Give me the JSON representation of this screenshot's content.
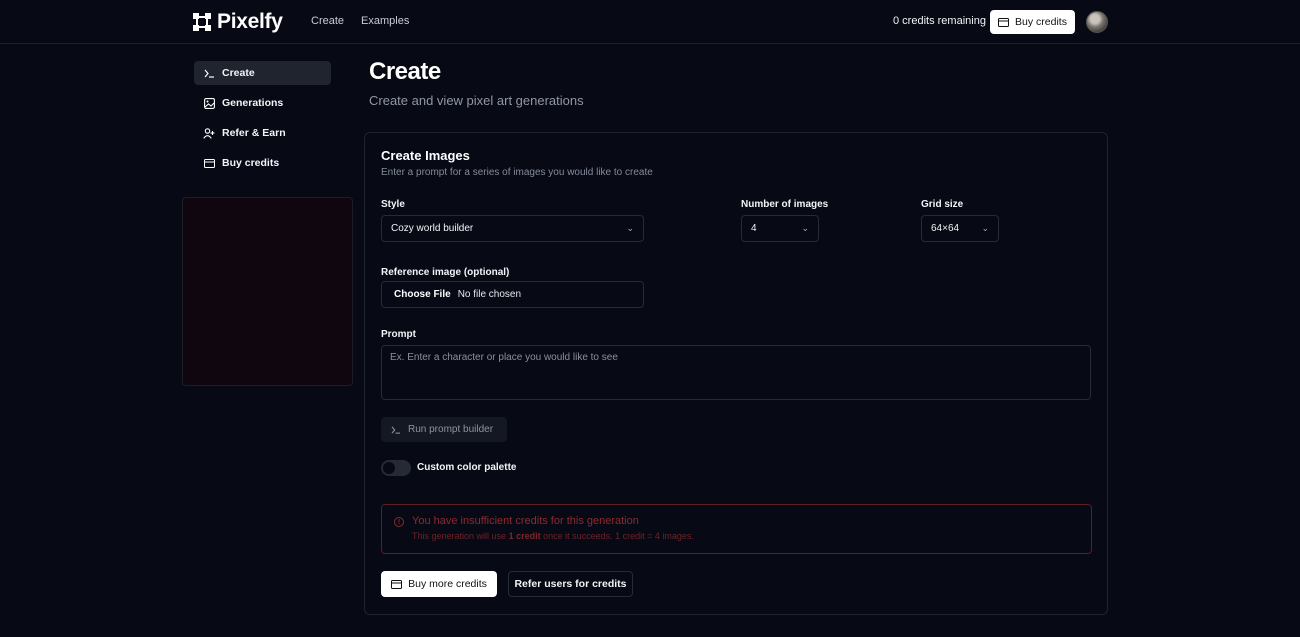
{
  "header": {
    "brand": "Pixelfy",
    "nav": [
      "Create",
      "Examples"
    ],
    "credits_text": "0 credits remaining",
    "buy_label": "Buy credits"
  },
  "sidebar": {
    "items": [
      {
        "label": "Create",
        "icon": "terminal-icon",
        "active": true
      },
      {
        "label": "Generations",
        "icon": "gallery-icon",
        "active": false
      },
      {
        "label": "Refer & Earn",
        "icon": "user-plus-icon",
        "active": false
      },
      {
        "label": "Buy credits",
        "icon": "credit-card-icon",
        "active": false
      }
    ]
  },
  "main": {
    "title": "Create",
    "subtitle": "Create and view pixel art generations"
  },
  "card": {
    "title": "Create Images",
    "description": "Enter a prompt for a series of images you would like to create",
    "style": {
      "label": "Style",
      "value": "Cozy world builder"
    },
    "num_images": {
      "label": "Number of images",
      "value": "4"
    },
    "grid_size": {
      "label": "Grid size",
      "value": "64×64"
    },
    "reference": {
      "label": "Reference image (optional)",
      "button": "Choose File",
      "status": "No file chosen"
    },
    "prompt": {
      "label": "Prompt",
      "placeholder": "Ex. Enter a character or place you would like to see"
    },
    "prompt_builder_label": "Run prompt builder",
    "palette_toggle": {
      "label": "Custom color palette",
      "on": false
    },
    "alert": {
      "title": "You have insufficient credits for this generation",
      "desc_prefix": "This generation will use ",
      "desc_bold": "1 credit",
      "desc_suffix": " once it succeeds. 1 credit = 4 images."
    },
    "buy_more_label": "Buy more credits",
    "refer_label": "Refer users for credits"
  },
  "colors": {
    "background": "#070a14",
    "alert": "#8b2a31",
    "primary_button": "#ffffff"
  }
}
